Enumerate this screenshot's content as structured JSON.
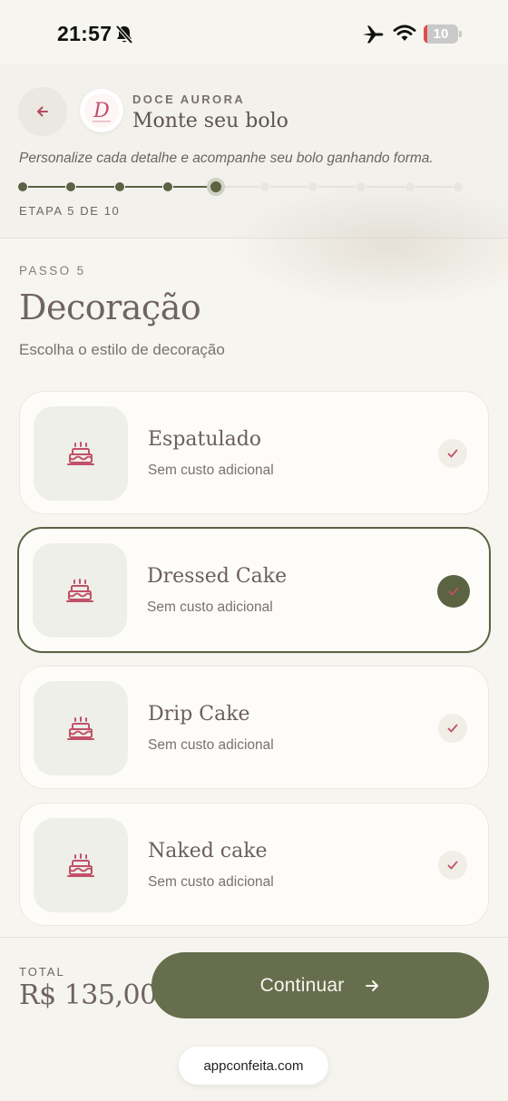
{
  "status_bar": {
    "time": "21:57",
    "battery_level": "10",
    "battery_percent": 10,
    "icons": [
      "bell-slash-icon",
      "airplane-icon",
      "wifi-icon",
      "battery-icon"
    ]
  },
  "header": {
    "brand_name": "DOCE AURORA",
    "logo_letter": "D",
    "title": "Monte seu bolo",
    "subtitle": "Personalize cada detalhe e acompanhe seu bolo ganhando forma.",
    "step_counter": "ETAPA 5 DE 10",
    "progress": {
      "current_step": 5,
      "total_steps": 10
    }
  },
  "main": {
    "step_label": "PASSO 5",
    "section_title": "Decoração",
    "section_description": "Escolha o estilo de decoração",
    "options": [
      {
        "name": "Espatulado",
        "price": "Sem custo adicional",
        "selected": false
      },
      {
        "name": "Dressed Cake",
        "price": "Sem custo adicional",
        "selected": true
      },
      {
        "name": "Drip Cake",
        "price": "Sem custo adicional",
        "selected": false
      },
      {
        "name": "Naked cake",
        "price": "Sem custo adicional",
        "selected": false
      }
    ]
  },
  "footer": {
    "total_label": "TOTAL",
    "total_value": "R$ 135,00",
    "continue_label": "Continuar",
    "url": "appconfeita.com"
  },
  "colors": {
    "background": "#f7f5ef",
    "accent_green": "#5b6343",
    "button_green": "#666e4d",
    "rose": "#c2506a",
    "text": "#6f6461"
  }
}
